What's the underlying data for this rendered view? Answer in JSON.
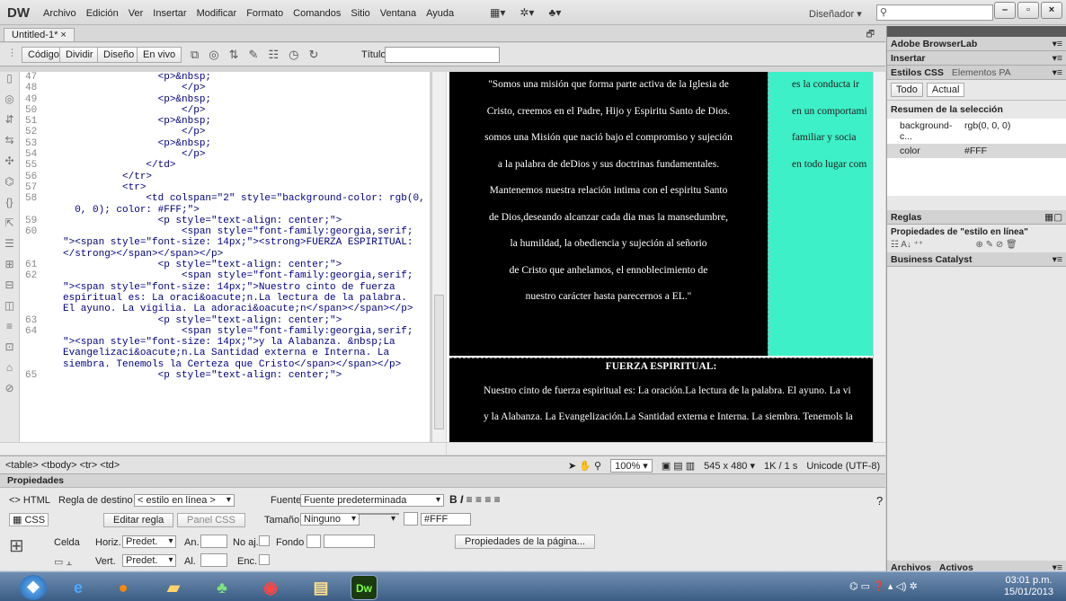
{
  "app": {
    "logo": "DW",
    "menu": [
      "Archivo",
      "Edición",
      "Ver",
      "Insertar",
      "Modificar",
      "Formato",
      "Comandos",
      "Sitio",
      "Ventana",
      "Ayuda"
    ],
    "workspace": "Diseñador",
    "search_placeholder": ""
  },
  "window": {
    "minimize": "–",
    "restore": "▫",
    "close": "×"
  },
  "doc_tab": "Untitled-1*",
  "doc_tab_close": "×",
  "view_buttons": [
    "Código",
    "Dividir",
    "Diseño",
    "En vivo"
  ],
  "title_label": "Título:",
  "gutter_icons": [
    "▯",
    "◎",
    "⇵",
    "⇆",
    "✣",
    "⌬",
    "{}",
    "⇱",
    "☰",
    "⊞",
    "⊟",
    "◫",
    "≡",
    "⊡",
    "⌂",
    "⊘"
  ],
  "code_lines": [
    {
      "n": "47",
      "t": "                <p>&nbsp;"
    },
    {
      "n": "48",
      "t": "                    </p>"
    },
    {
      "n": "49",
      "t": "                <p>&nbsp;"
    },
    {
      "n": "50",
      "t": "                    </p>"
    },
    {
      "n": "51",
      "t": "                <p>&nbsp;"
    },
    {
      "n": "52",
      "t": "                    </p>"
    },
    {
      "n": "53",
      "t": "                <p>&nbsp;"
    },
    {
      "n": "54",
      "t": "                    </p>"
    },
    {
      "n": "55",
      "t": "              </td>"
    },
    {
      "n": "56",
      "t": "          </tr>"
    },
    {
      "n": "57",
      "t": "          <tr>"
    },
    {
      "n": "58",
      "t": "              <td colspan=\"2\" style=\"background-color: rgb(0,"
    },
    {
      "n": "",
      "t": "  0, 0); color: #FFF;\">"
    },
    {
      "n": "59",
      "t": "                <p style=\"text-align: center;\">"
    },
    {
      "n": "60",
      "t": "                    <span style=\"font-family:georgia,serif;"
    },
    {
      "n": "",
      "t": "\"><span style=\"font-size: 14px;\"><strong>FUERZA ESPIRITUAL:"
    },
    {
      "n": "",
      "t": "</strong></span></span></p>"
    },
    {
      "n": "61",
      "t": "                <p style=\"text-align: center;\">"
    },
    {
      "n": "62",
      "t": "                    <span style=\"font-family:georgia,serif;"
    },
    {
      "n": "",
      "t": "\"><span style=\"font-size: 14px;\">Nuestro cinto de fuerza"
    },
    {
      "n": "",
      "t": "espiritual es: La oraci&oacute;n.La lectura de la palabra."
    },
    {
      "n": "",
      "t": "El ayuno. La vigilia. La adoraci&oacute;n</span></span></p>"
    },
    {
      "n": "63",
      "t": "                <p style=\"text-align: center;\">"
    },
    {
      "n": "64",
      "t": "                    <span style=\"font-family:georgia,serif;"
    },
    {
      "n": "",
      "t": "\"><span style=\"font-size: 14px;\">y la Alabanza. &nbsp;La"
    },
    {
      "n": "",
      "t": "Evangelizaci&oacute;n.La Santidad externa e Interna. La"
    },
    {
      "n": "",
      "t": "siembra. Tenemols la Certeza que Cristo</span></span></p>"
    },
    {
      "n": "65",
      "t": "                <p style=\"text-align: center;\">"
    }
  ],
  "design": {
    "black_lines": [
      "\"Somos una misión que  forma parte activa de la Iglesia de",
      "Cristo, creemos en el Padre, Hijo y Espiritu Santo de Dios.",
      "somos  una Misión  que nació bajo el compromiso y sujeción",
      "a la palabra de deDios y sus doctrinas fundamentales.",
      "Mantenemos nuestra relación intima con el espiritu Santo",
      "de Dios,deseando alcanzar cada dia mas la mansedumbre,",
      "la humildad, la obediencia y sujeción al señorio",
      "de Cristo que anhelamos, el ennoblecimiento de",
      "nuestro carácter hasta parecernos a EL.\""
    ],
    "cyan_lines": [
      "es la conducta ir",
      "en un comportami",
      "familiar y socia",
      "en todo lugar com"
    ],
    "heading": "FUERZA ESPIRITUAL:",
    "bottom_lines": [
      "Nuestro cinto de fuerza espiritual es: La oración.La lectura de la palabra. El ayuno. La vi",
      "y la Alabanza.  La Evangelización.La Santidad externa e Interna. La siembra. Tenemols la"
    ]
  },
  "status": {
    "tags": "<table> <tbody> <tr> <td>",
    "zoom": "100%",
    "size": "545 x 480",
    "download": "1K / 1 s",
    "encoding": "Unicode (UTF-8)"
  },
  "properties": {
    "title": "Propiedades",
    "html_btn": "<> HTML",
    "css_btn": "CSS",
    "target_rule_label": "Regla de destino",
    "target_rule": "< estilo en línea >",
    "font_label": "Fuente",
    "font_value": "Fuente predeterminada",
    "size_label": "Tamaño",
    "size_value": "Ninguno",
    "color": "#FFF",
    "edit_rule": "Editar regla",
    "css_panel": "Panel CSS",
    "cell": "Celda",
    "horiz_label": "Horiz.",
    "horiz_value": "Predet.",
    "width_label": "An.",
    "nowrap_label": "No aj.",
    "bg_label": "Fondo",
    "vert_label": "Vert.",
    "vert_value": "Predet.",
    "height_label": "Al.",
    "header_label": "Enc.",
    "page_props": "Propiedades de la página..."
  },
  "right_panel": {
    "browserlab": "Adobe BrowserLab",
    "insert": "Insertar",
    "css_tab": "Estilos CSS",
    "ap_tab": "Elementos PA",
    "all": "Todo",
    "current": "Actual",
    "summary": "Resumen de la selección",
    "props": [
      {
        "name": "background-c...",
        "value": "rgb(0, 0, 0)"
      },
      {
        "name": "color",
        "value": "#FFF"
      }
    ],
    "rules": "Reglas",
    "inline_props": "Propiedades de \"estilo en línea\"",
    "business": "Business Catalyst",
    "files": "Archivos",
    "assets": "Activos"
  },
  "taskbar": {
    "time": "03:01 p.m.",
    "date": "15/01/2013",
    "dw": "Dw"
  }
}
